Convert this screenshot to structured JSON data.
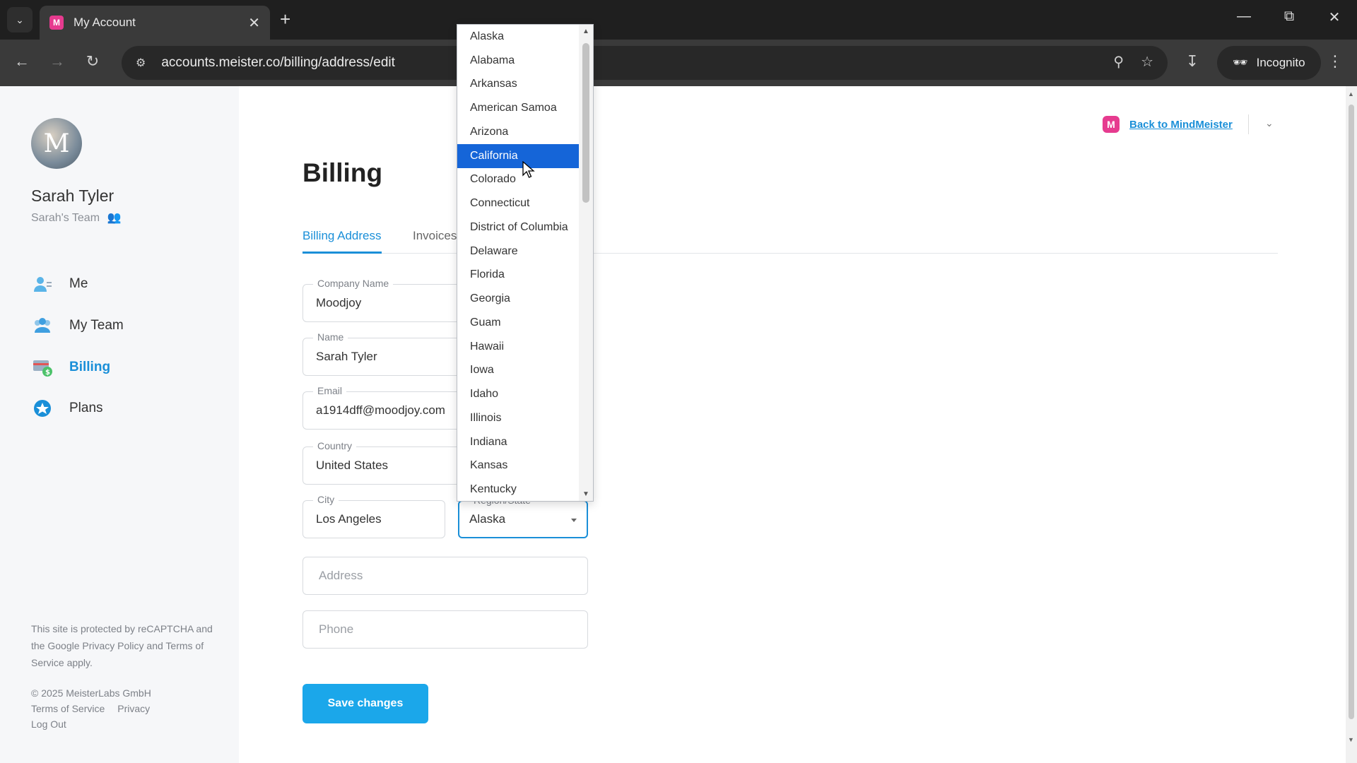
{
  "browser": {
    "tab_title": "My Account",
    "url": "accounts.meister.co/billing/address/edit",
    "incognito_label": "Incognito",
    "favicon_letter": "M"
  },
  "sidebar": {
    "user_name": "Sarah Tyler",
    "team_name": "Sarah's Team",
    "avatar_letter": "M",
    "nav": [
      {
        "label": "Me",
        "icon": "person-icon"
      },
      {
        "label": "My Team",
        "icon": "team-icon"
      },
      {
        "label": "Billing",
        "icon": "billing-icon",
        "active": true
      },
      {
        "label": "Plans",
        "icon": "plans-icon"
      }
    ],
    "legal_text": "This site is protected by reCAPTCHA and the Google Privacy Policy and Terms of Service apply.",
    "copyright": "© 2025 MeisterLabs GmbH",
    "footer_terms": "Terms of Service",
    "footer_privacy": "Privacy",
    "footer_logout": "Log Out"
  },
  "header": {
    "back_link": "Back to MindMeister",
    "logo_letter": "M"
  },
  "main": {
    "title": "Billing",
    "tabs": [
      {
        "label": "Billing Address",
        "active": true
      },
      {
        "label": "Invoices"
      }
    ],
    "fields": {
      "company": {
        "label": "Company Name",
        "value": "Moodjoy"
      },
      "name": {
        "label": "Name",
        "value": "Sarah Tyler"
      },
      "email": {
        "label": "Email",
        "value": "a1914dff@moodjoy.com"
      },
      "country": {
        "label": "Country",
        "value": "United States"
      },
      "city": {
        "label": "City",
        "value": "Los Angeles"
      },
      "region": {
        "label": "Region/State",
        "value": "Alaska"
      },
      "address": {
        "placeholder": "Address"
      },
      "phone": {
        "placeholder": "Phone"
      }
    },
    "save_label": "Save changes"
  },
  "region_dropdown": {
    "highlighted": "California",
    "options": [
      "Alaska",
      "Alabama",
      "Arkansas",
      "American Samoa",
      "Arizona",
      "California",
      "Colorado",
      "Connecticut",
      "District of Columbia",
      "Delaware",
      "Florida",
      "Georgia",
      "Guam",
      "Hawaii",
      "Iowa",
      "Idaho",
      "Illinois",
      "Indiana",
      "Kansas",
      "Kentucky"
    ]
  },
  "colors": {
    "accent": "#1a8fd8",
    "button": "#1ba7ea",
    "selected_option": "#1565d8",
    "brand": "#e63b8f"
  }
}
